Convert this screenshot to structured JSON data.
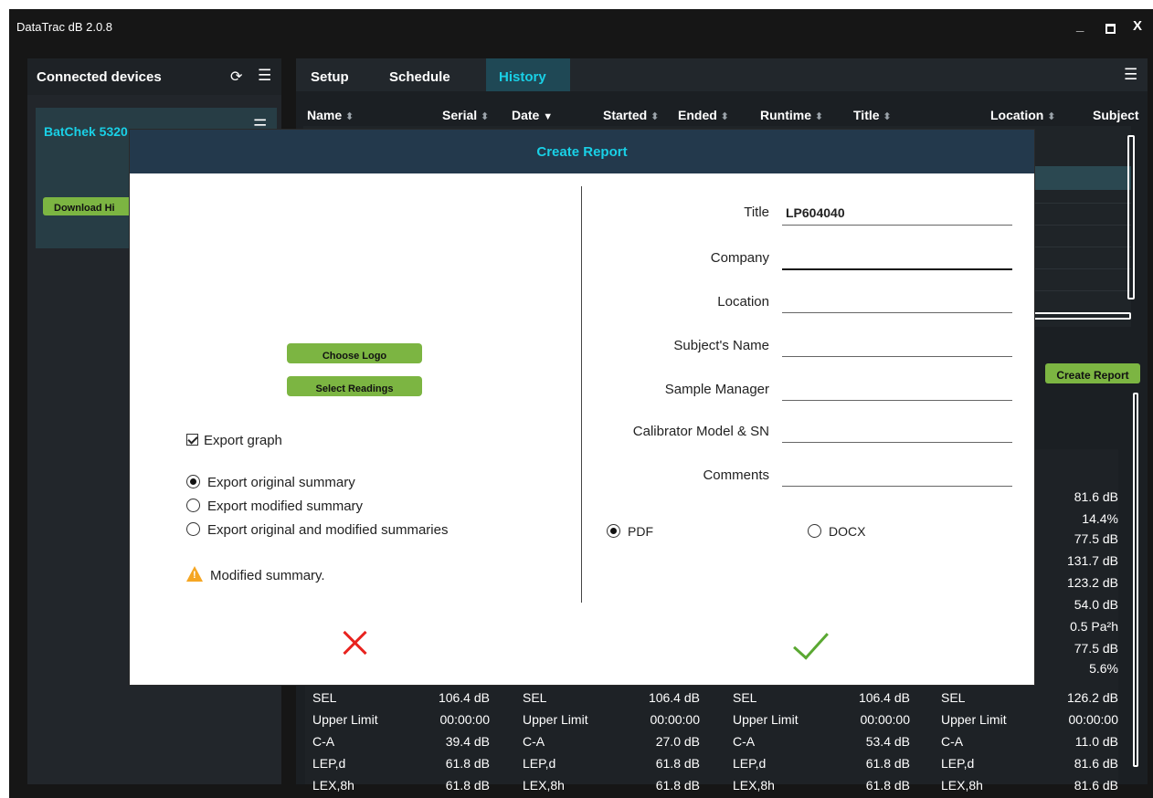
{
  "window": {
    "title": "DataTrac dB 2.0.8",
    "minimize": "_",
    "close": "X"
  },
  "left_panel": {
    "title": "Connected devices",
    "refresh_icon": "⟳",
    "menu_icon": "☰",
    "device": {
      "name": "BatChek 5320",
      "menu_icon": "☰",
      "download_label": "Download Hi"
    }
  },
  "right_panel": {
    "tabs": [
      "Setup",
      "Schedule",
      "History"
    ],
    "active_tab": "History",
    "menu_icon": "☰",
    "columns": [
      "Name",
      "Serial",
      "Date",
      "Started",
      "Ended",
      "Runtime",
      "Title",
      "Location",
      "Subject"
    ],
    "create_report_label": "Create Report",
    "right_col_values": [
      "81.6 dB",
      "14.4%",
      "77.5 dB",
      "131.7 dB",
      "123.2 dB",
      "54.0 dB",
      "0.5 Pa²h",
      "77.5 dB",
      "5.6%"
    ],
    "summary_rows": [
      {
        "label": "SEL",
        "values": [
          "106.4 dB",
          "106.4 dB",
          "106.4 dB",
          "126.2 dB"
        ]
      },
      {
        "label": "Upper Limit",
        "values": [
          "00:00:00",
          "00:00:00",
          "00:00:00",
          "00:00:00"
        ]
      },
      {
        "label": "C-A",
        "values": [
          "39.4 dB",
          "27.0 dB",
          "53.4 dB",
          "11.0 dB"
        ]
      },
      {
        "label": "LEP,d",
        "values": [
          "61.8 dB",
          "61.8 dB",
          "61.8 dB",
          "81.6 dB"
        ]
      },
      {
        "label": "LEX,8h",
        "values": [
          "61.8 dB",
          "61.8 dB",
          "61.8 dB",
          "81.6 dB"
        ]
      }
    ]
  },
  "dialog": {
    "title": "Create Report",
    "choose_logo": "Choose Logo",
    "select_readings": "Select Readings",
    "export_graph": "Export graph",
    "summary_options": [
      "Export original summary",
      "Export modified summary",
      "Export original and modified summaries"
    ],
    "selected_summary": "Export original summary",
    "warning": "Modified summary.",
    "fields": [
      {
        "label": "Title",
        "value": "LP604040"
      },
      {
        "label": "Company",
        "value": ""
      },
      {
        "label": "Location",
        "value": ""
      },
      {
        "label": "Subject's Name",
        "value": ""
      },
      {
        "label": "Sample Manager",
        "value": ""
      },
      {
        "label": "Calibrator Model & SN",
        "value": ""
      },
      {
        "label": "Comments",
        "value": ""
      }
    ],
    "formats": [
      "PDF",
      "DOCX"
    ],
    "selected_format": "PDF",
    "colors": {
      "accent": "#19d0e6",
      "button": "#7cb542",
      "cancel": "#e8231f",
      "ok": "#5aa832",
      "warning": "#f5a623"
    }
  }
}
